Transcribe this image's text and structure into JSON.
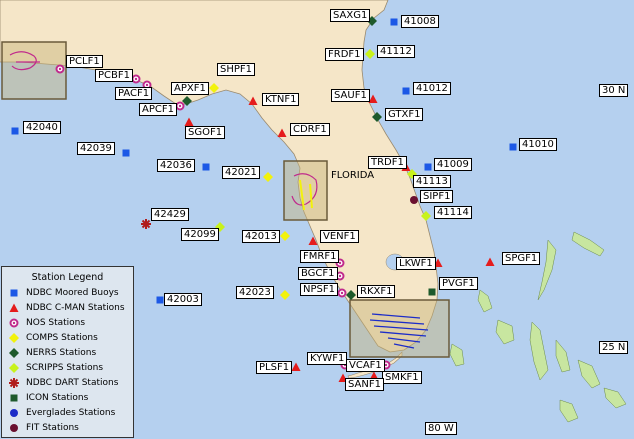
{
  "map": {
    "place_label": "FLORIDA",
    "grid_labels": {
      "lat_30": "30 N",
      "lat_25": "25 N",
      "lon_80": "80 W"
    }
  },
  "legend": {
    "title": "Station Legend",
    "items": [
      {
        "label": "NDBC Moored Buoys",
        "symbol": "square",
        "color": "#1c58e6"
      },
      {
        "label": "NDBC C-MAN Stations",
        "symbol": "triangle",
        "color": "#e51c1c"
      },
      {
        "label": "NOS Stations",
        "symbol": "ring",
        "color": "#c02a8c"
      },
      {
        "label": "COMPS Stations",
        "symbol": "diamond",
        "color": "#f2f20c"
      },
      {
        "label": "NERRS Stations",
        "symbol": "diamond",
        "color": "#1e5a2c"
      },
      {
        "label": "SCRIPPS  Stations",
        "symbol": "diamond",
        "color": "#c8f21c"
      },
      {
        "label": "NDBC DART Stations",
        "symbol": "star",
        "color": "#b01c1c"
      },
      {
        "label": "ICON Stations",
        "symbol": "square",
        "color": "#1e5a2c"
      },
      {
        "label": "Everglades Stations",
        "symbol": "circle",
        "color": "#1c2cc8"
      },
      {
        "label": "FIT Stations",
        "symbol": "circle",
        "color": "#6a1030"
      }
    ]
  },
  "stations": [
    {
      "id": "SAXG1",
      "type": "NERRS"
    },
    {
      "id": "41008",
      "type": "NDBC Moored Buoy"
    },
    {
      "id": "FRDF1",
      "type": "NDBC C-MAN"
    },
    {
      "id": "41112",
      "type": "SCRIPPS"
    },
    {
      "id": "41012",
      "type": "NDBC Moored Buoy"
    },
    {
      "id": "SAUF1",
      "type": "NDBC C-MAN"
    },
    {
      "id": "GTXF1",
      "type": "NERRS"
    },
    {
      "id": "PCLF1",
      "type": "NOS"
    },
    {
      "id": "PCBF1",
      "type": "NOS"
    },
    {
      "id": "PACF1",
      "type": "NOS"
    },
    {
      "id": "APCF1",
      "type": "NOS"
    },
    {
      "id": "APXF1",
      "type": "NERRS"
    },
    {
      "id": "SHPF1",
      "type": "COMPS"
    },
    {
      "id": "KTNF1",
      "type": "NDBC C-MAN"
    },
    {
      "id": "SGOF1",
      "type": "NDBC C-MAN"
    },
    {
      "id": "CDRF1",
      "type": "NDBC C-MAN"
    },
    {
      "id": "42040",
      "type": "NDBC Moored Buoy"
    },
    {
      "id": "42039",
      "type": "NDBC Moored Buoy"
    },
    {
      "id": "42036",
      "type": "NDBC Moored Buoy"
    },
    {
      "id": "42021",
      "type": "COMPS"
    },
    {
      "id": "41010",
      "type": "NDBC Moored Buoy"
    },
    {
      "id": "TRDF1",
      "type": "NDBC C-MAN"
    },
    {
      "id": "41009",
      "type": "NDBC Moored Buoy"
    },
    {
      "id": "41113",
      "type": "SCRIPPS"
    },
    {
      "id": "SIPF1",
      "type": "FIT"
    },
    {
      "id": "41114",
      "type": "SCRIPPS"
    },
    {
      "id": "42429",
      "type": "NDBC DART"
    },
    {
      "id": "42099",
      "type": "SCRIPPS"
    },
    {
      "id": "42013",
      "type": "COMPS"
    },
    {
      "id": "VENF1",
      "type": "NDBC C-MAN"
    },
    {
      "id": "FMRF1",
      "type": "NOS"
    },
    {
      "id": "BGCF1",
      "type": "NOS"
    },
    {
      "id": "NPSF1",
      "type": "NOS"
    },
    {
      "id": "RKXF1",
      "type": "NERRS"
    },
    {
      "id": "42023",
      "type": "COMPS"
    },
    {
      "id": "42003",
      "type": "NDBC Moored Buoy"
    },
    {
      "id": "LKWF1",
      "type": "NDBC C-MAN"
    },
    {
      "id": "PVGF1",
      "type": "ICON"
    },
    {
      "id": "SPGF1",
      "type": "NDBC C-MAN"
    },
    {
      "id": "KYWF1",
      "type": "NOS"
    },
    {
      "id": "PLSF1",
      "type": "NDBC C-MAN"
    },
    {
      "id": "VCAF1",
      "type": "NOS"
    },
    {
      "id": "SMKF1",
      "type": "NDBC C-MAN"
    },
    {
      "id": "SANF1",
      "type": "NDBC C-MAN"
    }
  ]
}
